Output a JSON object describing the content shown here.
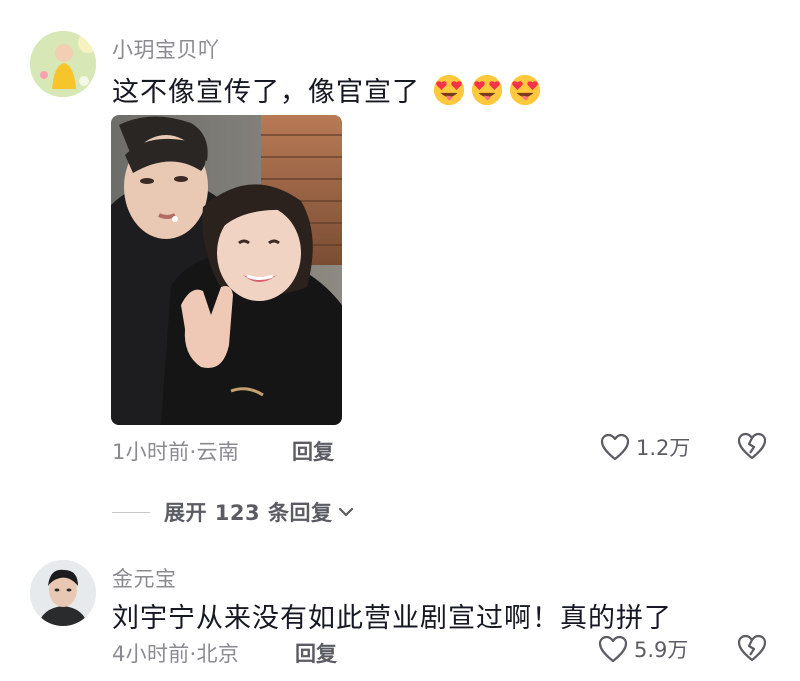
{
  "comments": [
    {
      "username": "小玥宝贝吖",
      "text": "这不像宣传了，像官宣了",
      "emoji": [
        "star-struck-tongue-emoji",
        "star-struck-tongue-emoji",
        "star-struck-tongue-emoji"
      ],
      "has_image": true,
      "meta": "1小时前·云南",
      "reply_label": "回复",
      "likes": "1.2万"
    },
    {
      "username": "金元宝",
      "text": "刘宇宁从来没有如此营业剧宣过啊！真的拼了",
      "meta": "4小时前·北京",
      "reply_label": "回复",
      "likes": "5.9万"
    }
  ],
  "expand_replies": {
    "label": "展开 123 条回复"
  },
  "colors": {
    "text_primary": "#161823",
    "text_secondary": "#8a8b91",
    "text_action": "#5b5c63",
    "emoji_face": "#ffc83d",
    "emoji_heart": "#f5314b"
  }
}
